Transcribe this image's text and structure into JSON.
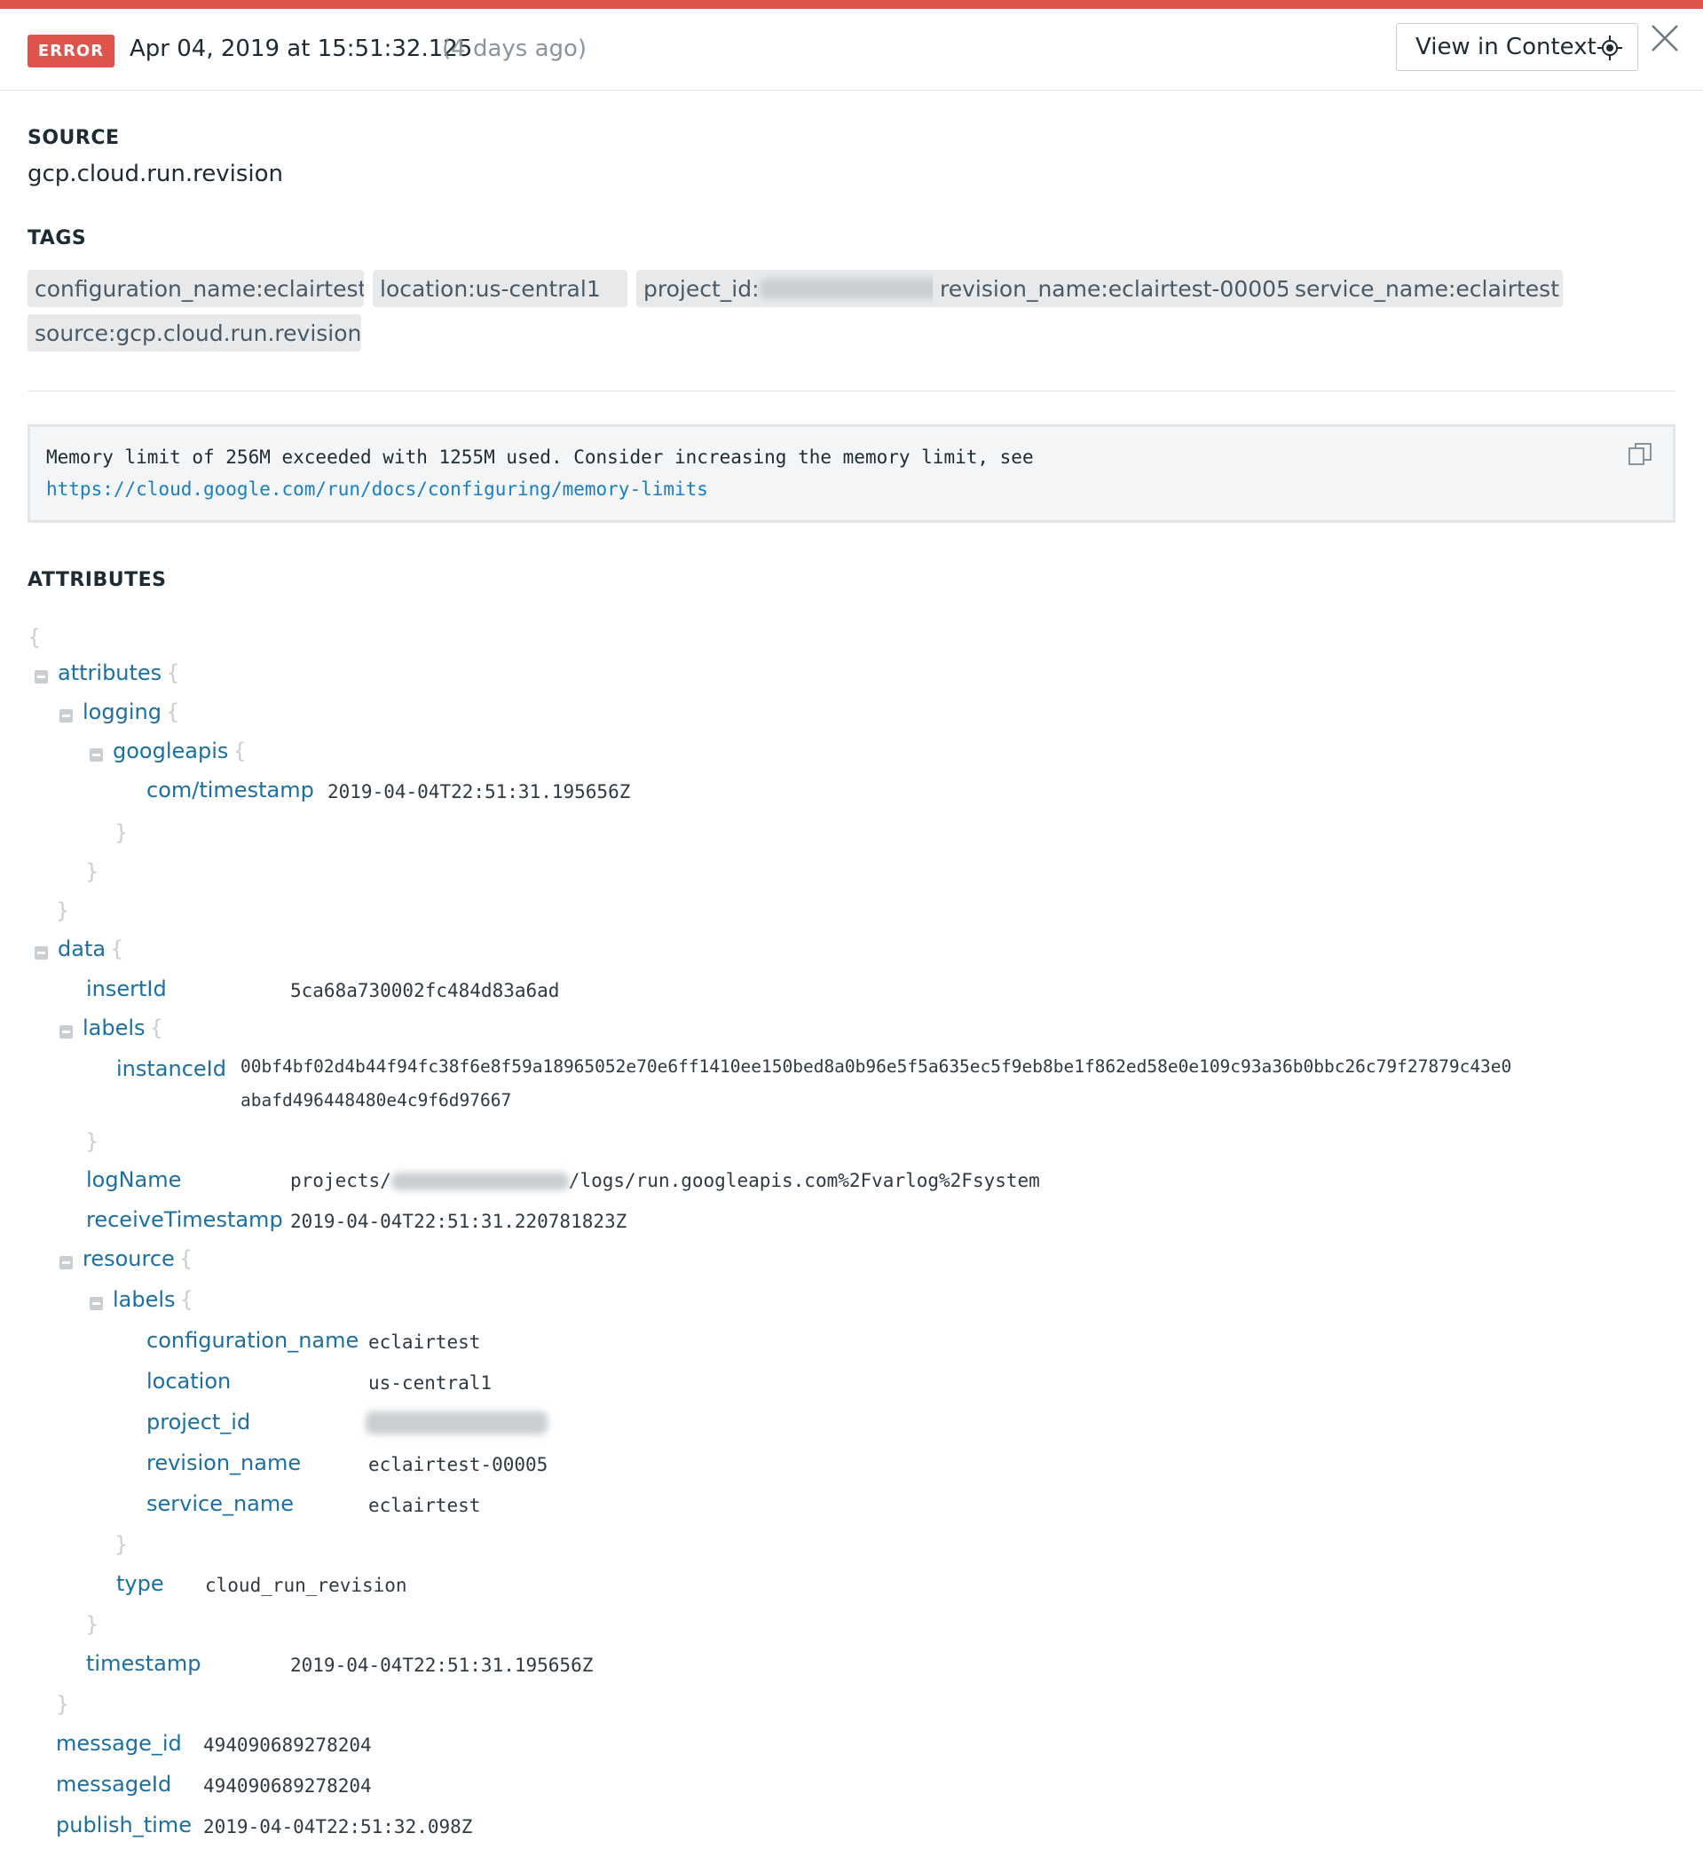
{
  "header": {
    "status": "ERROR",
    "date": "Apr 04, 2019 at 15:51:32.125",
    "relative": "(4 days ago)",
    "view_context_label": "View in Context",
    "accent_color": "#e0534c"
  },
  "source": {
    "label": "SOURCE",
    "value": "gcp.cloud.run.revision"
  },
  "tags": {
    "label": "TAGS",
    "items": [
      "configuration_name:eclairtest",
      "location:us-central1",
      "project_id:",
      "revision_name:eclairtest-00005",
      "service_name:eclairtest",
      "source:gcp.cloud.run.revision"
    ]
  },
  "message": {
    "text": "Memory limit of 256M exceeded with 1255M used. Consider increasing the memory limit, see",
    "link": "https://cloud.google.com/run/docs/configuring/memory-limits"
  },
  "attributes": {
    "label": "ATTRIBUTES",
    "open_brace": "{",
    "close_brace": "}",
    "keys": {
      "attributes": "attributes",
      "logging": "logging",
      "googleapis": "googleapis",
      "com_timestamp": "com/timestamp",
      "data": "data",
      "insertId": "insertId",
      "labels": "labels",
      "instanceId": "instanceId",
      "logName": "logName",
      "receiveTimestamp": "receiveTimestamp",
      "resource": "resource",
      "res_labels": "labels",
      "configuration_name": "configuration_name",
      "location": "location",
      "project_id": "project_id",
      "revision_name": "revision_name",
      "service_name": "service_name",
      "type": "type",
      "timestamp": "timestamp",
      "message_id": "message_id",
      "messageId": "messageId",
      "publish_time": "publish_time"
    },
    "values": {
      "com_timestamp": "2019-04-04T22:51:31.195656Z",
      "insertId": "5ca68a730002fc484d83a6ad",
      "instanceId_line1": "00bf4bf02d4b44f94fc38f6e8f59a18965052e70e6ff1410ee150bed8a0b96e5f5a635ec5f9eb8be1f862ed58e0e109c93a36b0bbc26c79f27879c43e0",
      "instanceId_line2": "abafd496448480e4c9f6d97667",
      "logName_prefix": "projects/",
      "logName_suffix": "/logs/run.googleapis.com%2Fvarlog%2Fsystem",
      "receiveTimestamp": "2019-04-04T22:51:31.220781823Z",
      "configuration_name": "eclairtest",
      "location": "us-central1",
      "revision_name": "eclairtest-00005",
      "service_name": "eclairtest",
      "type": "cloud_run_revision",
      "timestamp": "2019-04-04T22:51:31.195656Z",
      "message_id": "494090689278204",
      "messageId": "494090689278204",
      "publish_time": "2019-04-04T22:51:32.098Z"
    }
  }
}
